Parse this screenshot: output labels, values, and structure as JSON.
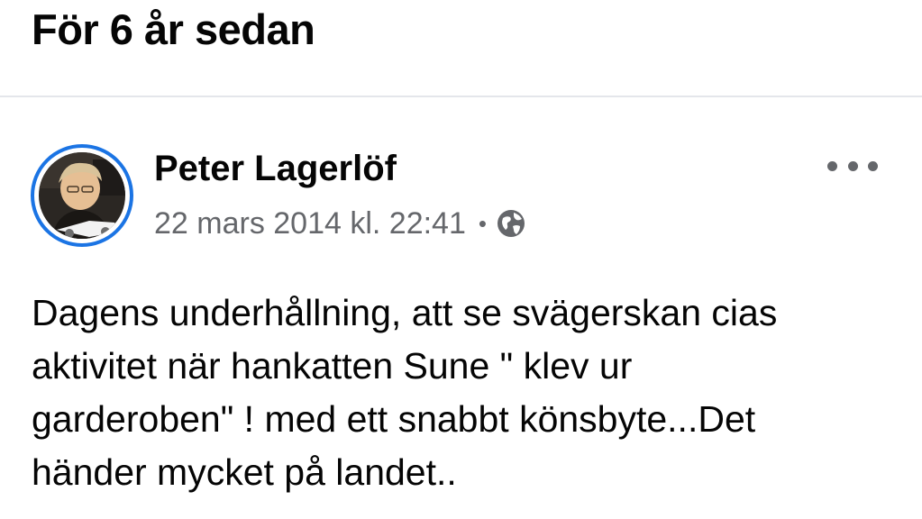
{
  "memory": {
    "section_title": "För 6 år sedan"
  },
  "post": {
    "author": "Peter Lagerlöf",
    "timestamp": "22 mars 2014 kl. 22:41",
    "separator": "•",
    "privacy_icon": "globe-icon",
    "options_icon": "more-options-icon",
    "text_lines": [
      "Dagens underhållning, att se svägerskan cias",
      "aktivitet när hankatten Sune \" klev ur",
      "garderoben\" ! med ett snabbt könsbyte...Det",
      "händer mycket på landet.."
    ]
  },
  "colors": {
    "avatar_ring": "#1b74e4",
    "secondary_text": "#65676b",
    "divider": "#e4e6eb",
    "primary_text": "#050505"
  }
}
